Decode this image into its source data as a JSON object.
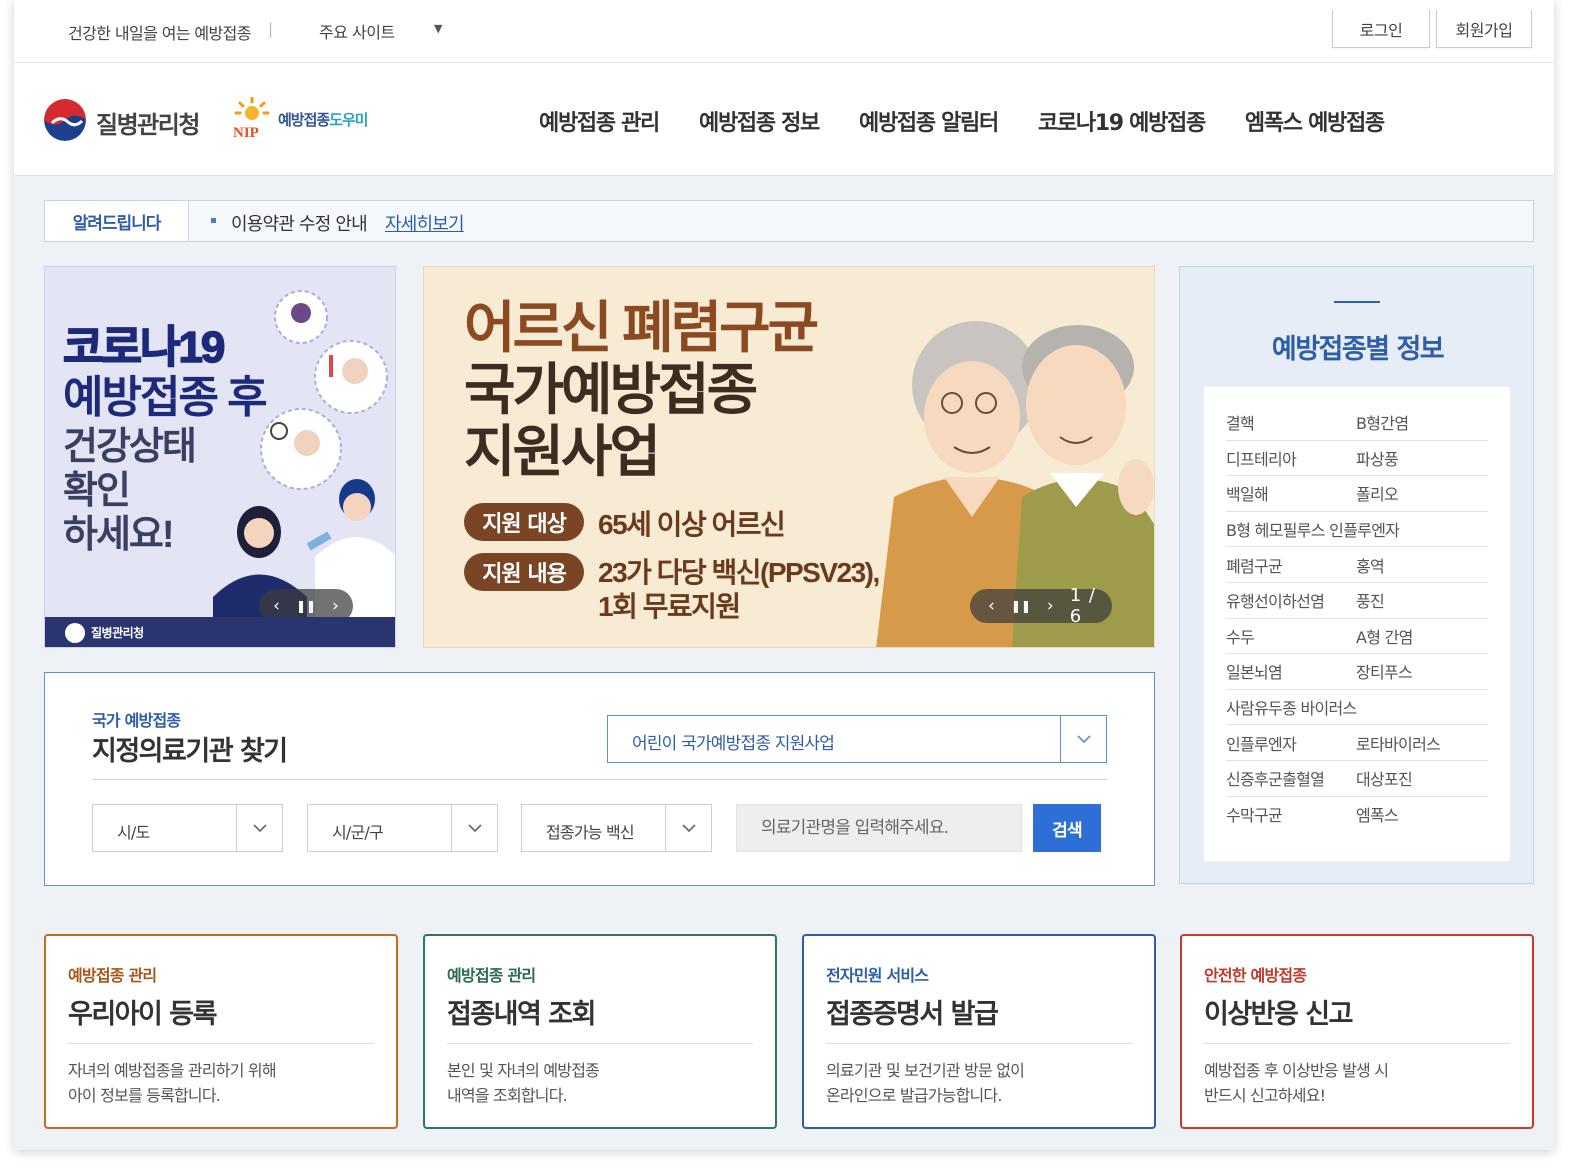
{
  "topbar": {
    "slogan": "건강한 내일을 여는 예방접종",
    "separator": "|",
    "sites_label": "주요 사이트",
    "sites_caret": "▼",
    "login": "로그인",
    "join": "회원가입"
  },
  "header": {
    "agency_name": "질병관리청",
    "nip_label": "예방접종",
    "nip_label_suffix": "도우미",
    "nip_badge": "NIP",
    "nav": [
      "예방접종 관리",
      "예방접종 정보",
      "예방접종 알림터",
      "코로나19 예방접종",
      "엠폭스 예방접종"
    ]
  },
  "notice": {
    "label": "알려드립니다",
    "text": "이용약관 수정 안내",
    "link": "자세히보기"
  },
  "banner_left": {
    "lines": [
      "코로나19",
      "예방접종 후",
      "건강상태",
      "확인",
      "하세요!"
    ],
    "footer_text": "질병관리청"
  },
  "banner_main": {
    "title_lines": [
      "어르신 폐렴구균",
      "국가예방접종",
      "지원사업"
    ],
    "badge_target": "지원 대상",
    "target_value": "65세 이상 어르신",
    "badge_content": "지원 내용",
    "content_value_1": "23가 다당 백신(PPSV23),",
    "content_value_2": "1회 무료지원",
    "slide_counter": "1 / 6"
  },
  "vaccine_info": {
    "title": "예방접종별 정보",
    "rows": [
      [
        "결핵",
        "B형간염"
      ],
      [
        "디프테리아",
        "파상풍"
      ],
      [
        "백일해",
        "폴리오"
      ],
      [
        "B형 헤모필루스 인플루엔자"
      ],
      [
        "폐렴구균",
        "홍역"
      ],
      [
        "유행선이하선염",
        "풍진"
      ],
      [
        "수두",
        "A형 간염"
      ],
      [
        "일본뇌염",
        "장티푸스"
      ],
      [
        "사람유두종 바이러스"
      ],
      [
        "인플루엔자",
        "로타바이러스"
      ],
      [
        "신증후군출혈열",
        "대상포진"
      ],
      [
        "수막구균",
        "엠폭스"
      ]
    ]
  },
  "search": {
    "subtitle": "국가 예방접종",
    "title": "지정의료기관 찾기",
    "program_selected": "어린이 국가예방접종 지원사업",
    "sido": "시/도",
    "sigungu": "시/군/구",
    "vaccine": "접종가능 백신",
    "input_placeholder": "의료기관명을 입력해주세요.",
    "button": "검색"
  },
  "cards": [
    {
      "sub": "예방접종 관리",
      "title": "우리아이 등록",
      "desc_1": "자녀의 예방접종을 관리하기 위해",
      "desc_2": "아이 정보를 등록합니다."
    },
    {
      "sub": "예방접종 관리",
      "title": "접종내역 조회",
      "desc_1": "본인 및 자녀의 예방접종",
      "desc_2": "내역을 조회합니다."
    },
    {
      "sub": "전자민원 서비스",
      "title": "접종증명서 발급",
      "desc_1": "의료기관 및 보건기관 방문 없이",
      "desc_2": "온라인으로 발급가능합니다."
    },
    {
      "sub": "안전한 예방접종",
      "title": "이상반응 신고",
      "desc_1": "예방접종 후 이상반응 발생 시",
      "desc_2": "반드시 신고하세요!"
    }
  ],
  "colors": {
    "primary_blue": "#2f5ea8",
    "search_button": "#2d6fd6",
    "card_orange": "#c46b1e",
    "card_green": "#2f7a54",
    "card_blue": "#2f5ea8",
    "card_red": "#c93a2b"
  },
  "icons": [
    "chevron-down-icon",
    "pause-icon",
    "chevron-left-icon",
    "chevron-right-icon",
    "caret-down-icon"
  ]
}
